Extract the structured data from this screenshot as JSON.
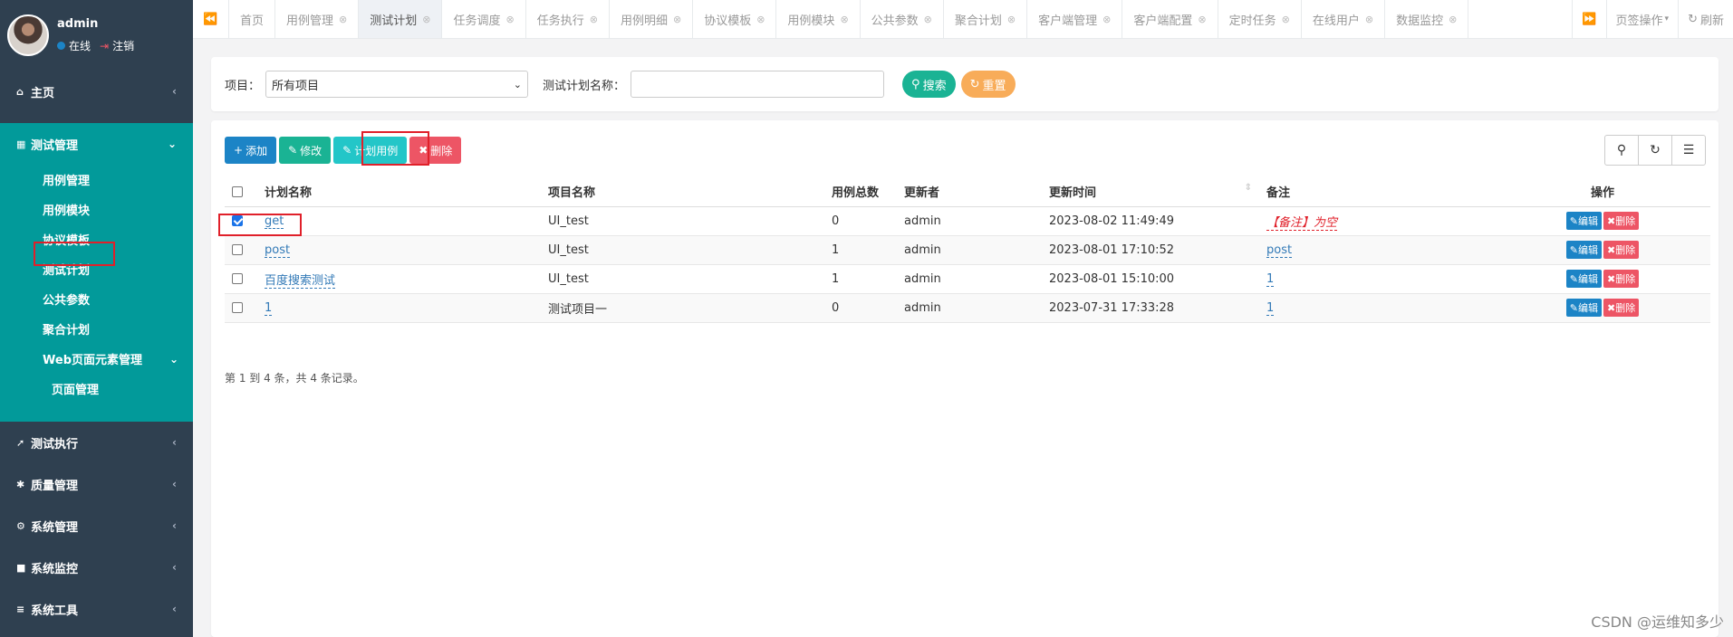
{
  "sidebar": {
    "user": {
      "name": "admin",
      "online": "在线",
      "logout": "注销"
    },
    "menu": [
      {
        "label": "主页",
        "icon": "home-icon"
      },
      {
        "label": "测试管理",
        "icon": "grid-icon"
      },
      {
        "label": "测试执行",
        "icon": "rocket-icon"
      },
      {
        "label": "质量管理",
        "icon": "bug-icon"
      },
      {
        "label": "系统管理",
        "icon": "gear-icon"
      },
      {
        "label": "系统监控",
        "icon": "video-icon"
      },
      {
        "label": "系统工具",
        "icon": "bars-icon"
      }
    ],
    "submenu": [
      "用例管理",
      "用例模块",
      "协议模板",
      "测试计划",
      "公共参数",
      "聚合计划",
      "Web页面元素管理",
      "页面管理"
    ]
  },
  "tabs": {
    "items": [
      "首页",
      "用例管理",
      "测试计划",
      "任务调度",
      "任务执行",
      "用例明细",
      "协议模板",
      "用例模块",
      "公共参数",
      "聚合计划",
      "客户端管理",
      "客户端配置",
      "定时任务",
      "在线用户",
      "数据监控"
    ],
    "active_index": 2,
    "page_ops": "页签操作",
    "refresh": "刷新"
  },
  "search": {
    "project_label": "项目：",
    "project_value": "所有项目",
    "plan_name_label": "测试计划名称：",
    "plan_name_value": "",
    "search_btn": "搜索",
    "reset_btn": "重置"
  },
  "toolbar": {
    "add": "添加",
    "edit": "修改",
    "plan_cases": "计划用例",
    "delete": "删除"
  },
  "table": {
    "headers": [
      "计划名称",
      "项目名称",
      "用例总数",
      "更新者",
      "更新时间",
      "备注",
      "操作"
    ],
    "rows": [
      {
        "checked": true,
        "name": "get",
        "project": "UI_test",
        "total": "0",
        "updater": "admin",
        "time": "2023-08-02 11:49:49",
        "remark": "【备注】为空",
        "remark_empty": true
      },
      {
        "checked": false,
        "name": "post",
        "project": "UI_test",
        "total": "1",
        "updater": "admin",
        "time": "2023-08-01 17:10:52",
        "remark": "post",
        "remark_empty": false
      },
      {
        "checked": false,
        "name": "百度搜索测试",
        "project": "UI_test",
        "total": "1",
        "updater": "admin",
        "time": "2023-08-01 15:10:00",
        "remark": "1",
        "remark_empty": false
      },
      {
        "checked": false,
        "name": "1",
        "project": "测试项目一",
        "total": "0",
        "updater": "admin",
        "time": "2023-07-31 17:33:28",
        "remark": "1",
        "remark_empty": false
      }
    ],
    "row_edit": "编辑",
    "row_delete": "删除",
    "pager": "第 1 到 4 条，共 4 条记录。"
  },
  "watermark": "CSDN @运维知多少"
}
